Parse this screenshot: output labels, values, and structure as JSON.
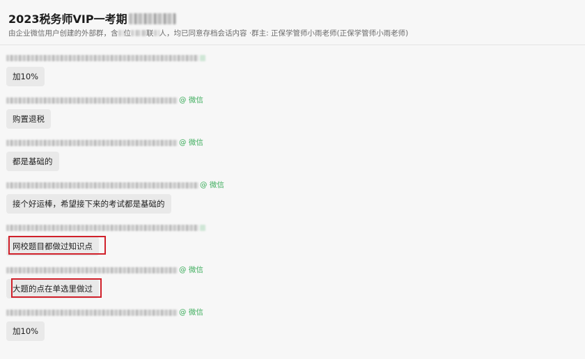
{
  "header": {
    "title": "2023税务师VIP一考期",
    "subtitle_prefix": "由企业微信用户创建的外部群，含",
    "subtitle_mid": "位",
    "subtitle_mid2": "联",
    "subtitle_suffix": "人，均已同意存档会话内容 ·群主: 正保学管师小雨老师(正保学管师小雨老师)"
  },
  "messages": [
    {
      "source": "",
      "text": "加10%"
    },
    {
      "source": "@ 微信",
      "text": "购置退税"
    },
    {
      "source": "@ 微信",
      "text": "都是基础的"
    },
    {
      "source": "@ 微信",
      "text": "接个好运棒，希望接下来的考试都是基础的"
    },
    {
      "source": "",
      "text": "网校题目都做过知识点",
      "highlighted": true
    },
    {
      "source": "@ 微信",
      "text": "大题的点在单选里做过",
      "highlighted": true
    },
    {
      "source": "@ 微信",
      "text": "加10%"
    }
  ],
  "colors": {
    "background": "#f7f7f7",
    "bubble": "#e9e9e9",
    "source_green": "#3fae5e",
    "highlight_red": "#d0202a"
  }
}
